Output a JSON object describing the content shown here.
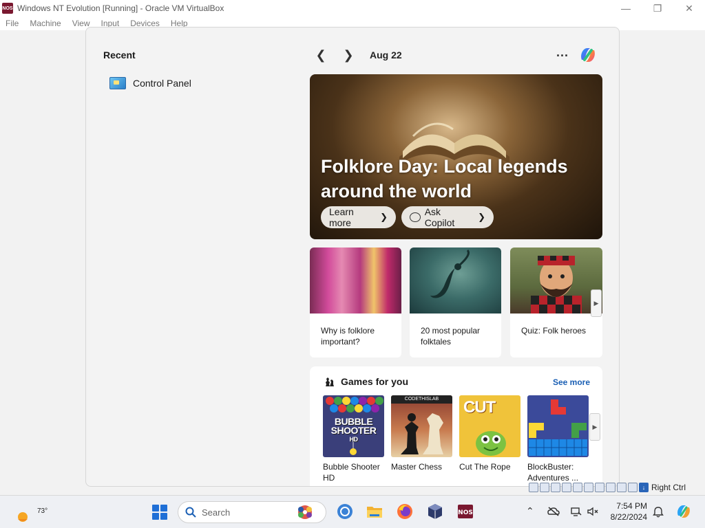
{
  "host": {
    "logo_text": "NOS",
    "title": "Windows NT Evolution [Running] - Oracle VM VirtualBox",
    "menu": [
      "File",
      "Machine",
      "View",
      "Input",
      "Devices",
      "Help"
    ],
    "status_label": "Right Ctrl"
  },
  "widgets": {
    "recent_heading": "Recent",
    "recent_items": [
      {
        "label": "Control Panel",
        "icon": "control-panel-icon"
      }
    ],
    "date": "Aug 22",
    "more_label": "...",
    "hero": {
      "title": "Folklore Day: Local legends around the world",
      "learn_more": "Learn more",
      "ask_copilot": "Ask Copilot"
    },
    "cards": [
      {
        "text": "Why is folklore important?"
      },
      {
        "text": "20 most popular folktales"
      },
      {
        "text": "Quiz: Folk heroes"
      }
    ],
    "games": {
      "heading": "Games for you",
      "see_more": "See more",
      "items": [
        {
          "name": "Bubble Shooter HD",
          "art": "BUBBLE SHOOTER",
          "art_sub": "HD"
        },
        {
          "name": "Master Chess",
          "art": "CODETHISLAB"
        },
        {
          "name": "Cut The Rope",
          "art": "CUT"
        },
        {
          "name": "BlockBuster: Adventures ..."
        }
      ]
    }
  },
  "taskbar": {
    "weather_temp": "73°",
    "search_placeholder": "Search",
    "clock_time": "7:54 PM",
    "clock_date": "8/22/2024",
    "apps": [
      "chrome-icon",
      "file-explorer-icon",
      "firefox-icon",
      "virtualbox-icon",
      "nos-icon"
    ],
    "colors": {
      "accent": "#1f6fd6",
      "link": "#1a5fb4"
    }
  }
}
